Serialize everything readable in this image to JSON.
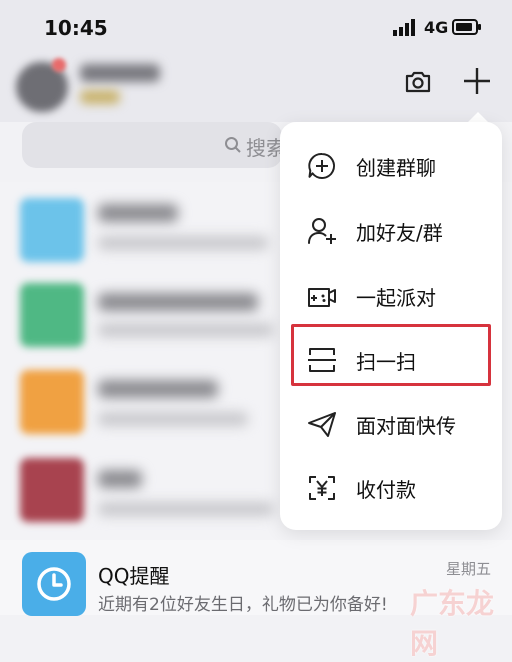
{
  "status_bar": {
    "time": "10:45",
    "network": "4G"
  },
  "search": {
    "placeholder": "搜索"
  },
  "menu": {
    "items": [
      {
        "label": "创建群聊",
        "icon": "create-group-chat-icon"
      },
      {
        "label": "加好友/群",
        "icon": "add-friend-icon"
      },
      {
        "label": "一起派对",
        "icon": "party-icon"
      },
      {
        "label": "扫一扫",
        "icon": "scan-icon"
      },
      {
        "label": "面对面快传",
        "icon": "paper-plane-icon"
      },
      {
        "label": "收付款",
        "icon": "payment-scan-icon"
      }
    ]
  },
  "conversation": {
    "title": "QQ提醒",
    "message": "近期有2位好友生日，礼物已为你备好!",
    "time": "星期五"
  },
  "watermark": "广东龙网",
  "colors": {
    "highlight": "#d6333d",
    "qq_blue": "#4aaee8"
  }
}
